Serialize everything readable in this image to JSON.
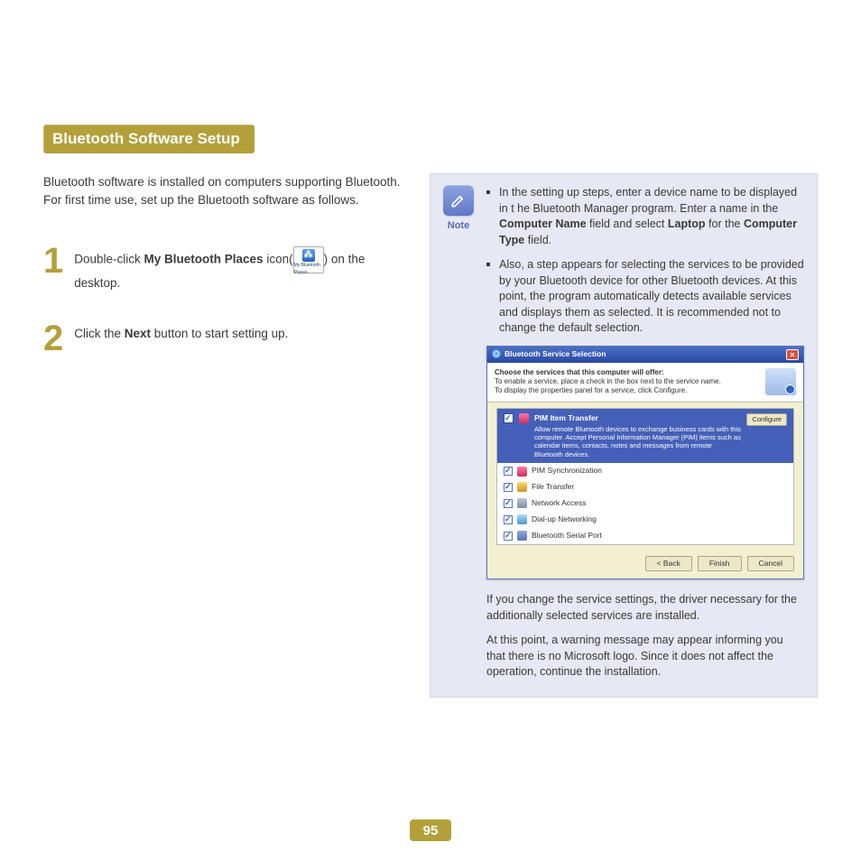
{
  "title": "Bluetooth Software Setup",
  "intro": "Bluetooth software is installed on computers supporting Bluetooth.\nFor first time use, set up the Bluetooth software as follows.",
  "steps": [
    {
      "num": "1",
      "before": "Double-click ",
      "bold": "My Bluetooth Places",
      "after_open": " icon(",
      "icon_label": "My Bluetooth Places",
      "after_close": ") on the desktop."
    },
    {
      "num": "2",
      "before": "Click the ",
      "bold": "Next",
      "after": " button to start setting up."
    }
  ],
  "note": {
    "label": "Note",
    "bullets": [
      {
        "pre": "In the setting up steps, enter a device name to be displayed in t he Bluetooth Manager program. Enter a name in the ",
        "b1": "Computer Name",
        "mid1": " field and select ",
        "b2": "Laptop",
        "mid2": " for the ",
        "b3": "Computer Type",
        "post": " field."
      },
      {
        "text": "Also, a step appears for selecting the services to be provided by your Bluetooth device for other Bluetooth devices. At this point, the program automatically detects available services and displays them as selected. It is recommended not to change the default selection."
      }
    ],
    "after1": "If you change the service settings, the driver necessary for the additionally selected services are installed.",
    "after2": "At this point, a warning message may appear informing you that there is no Microsoft logo. Since it does not affect the operation, continue the installation."
  },
  "dialog": {
    "title": "Bluetooth Service Selection",
    "head_bold": "Choose the services that this computer will offer:",
    "head_line1": "To enable a service, place a check in the box next to the service name.",
    "head_line2": "To display the properties panel for a service, click Configure.",
    "highlight": {
      "name": "PIM Item Transfer",
      "desc": "Allow remote Bluetooth devices to exchange business cards with this computer. Accept Personal Information Manager (PIM) items such as calendar items, contacts, notes and messages from remote Bluetooth devices.",
      "configure": "Configure"
    },
    "services": [
      "PIM Synchronization",
      "File Transfer",
      "Network Access",
      "Dial-up Networking",
      "Bluetooth Serial Port"
    ],
    "buttons": {
      "back": "< Back",
      "finish": "Finish",
      "cancel": "Cancel"
    }
  },
  "page_number": "95"
}
